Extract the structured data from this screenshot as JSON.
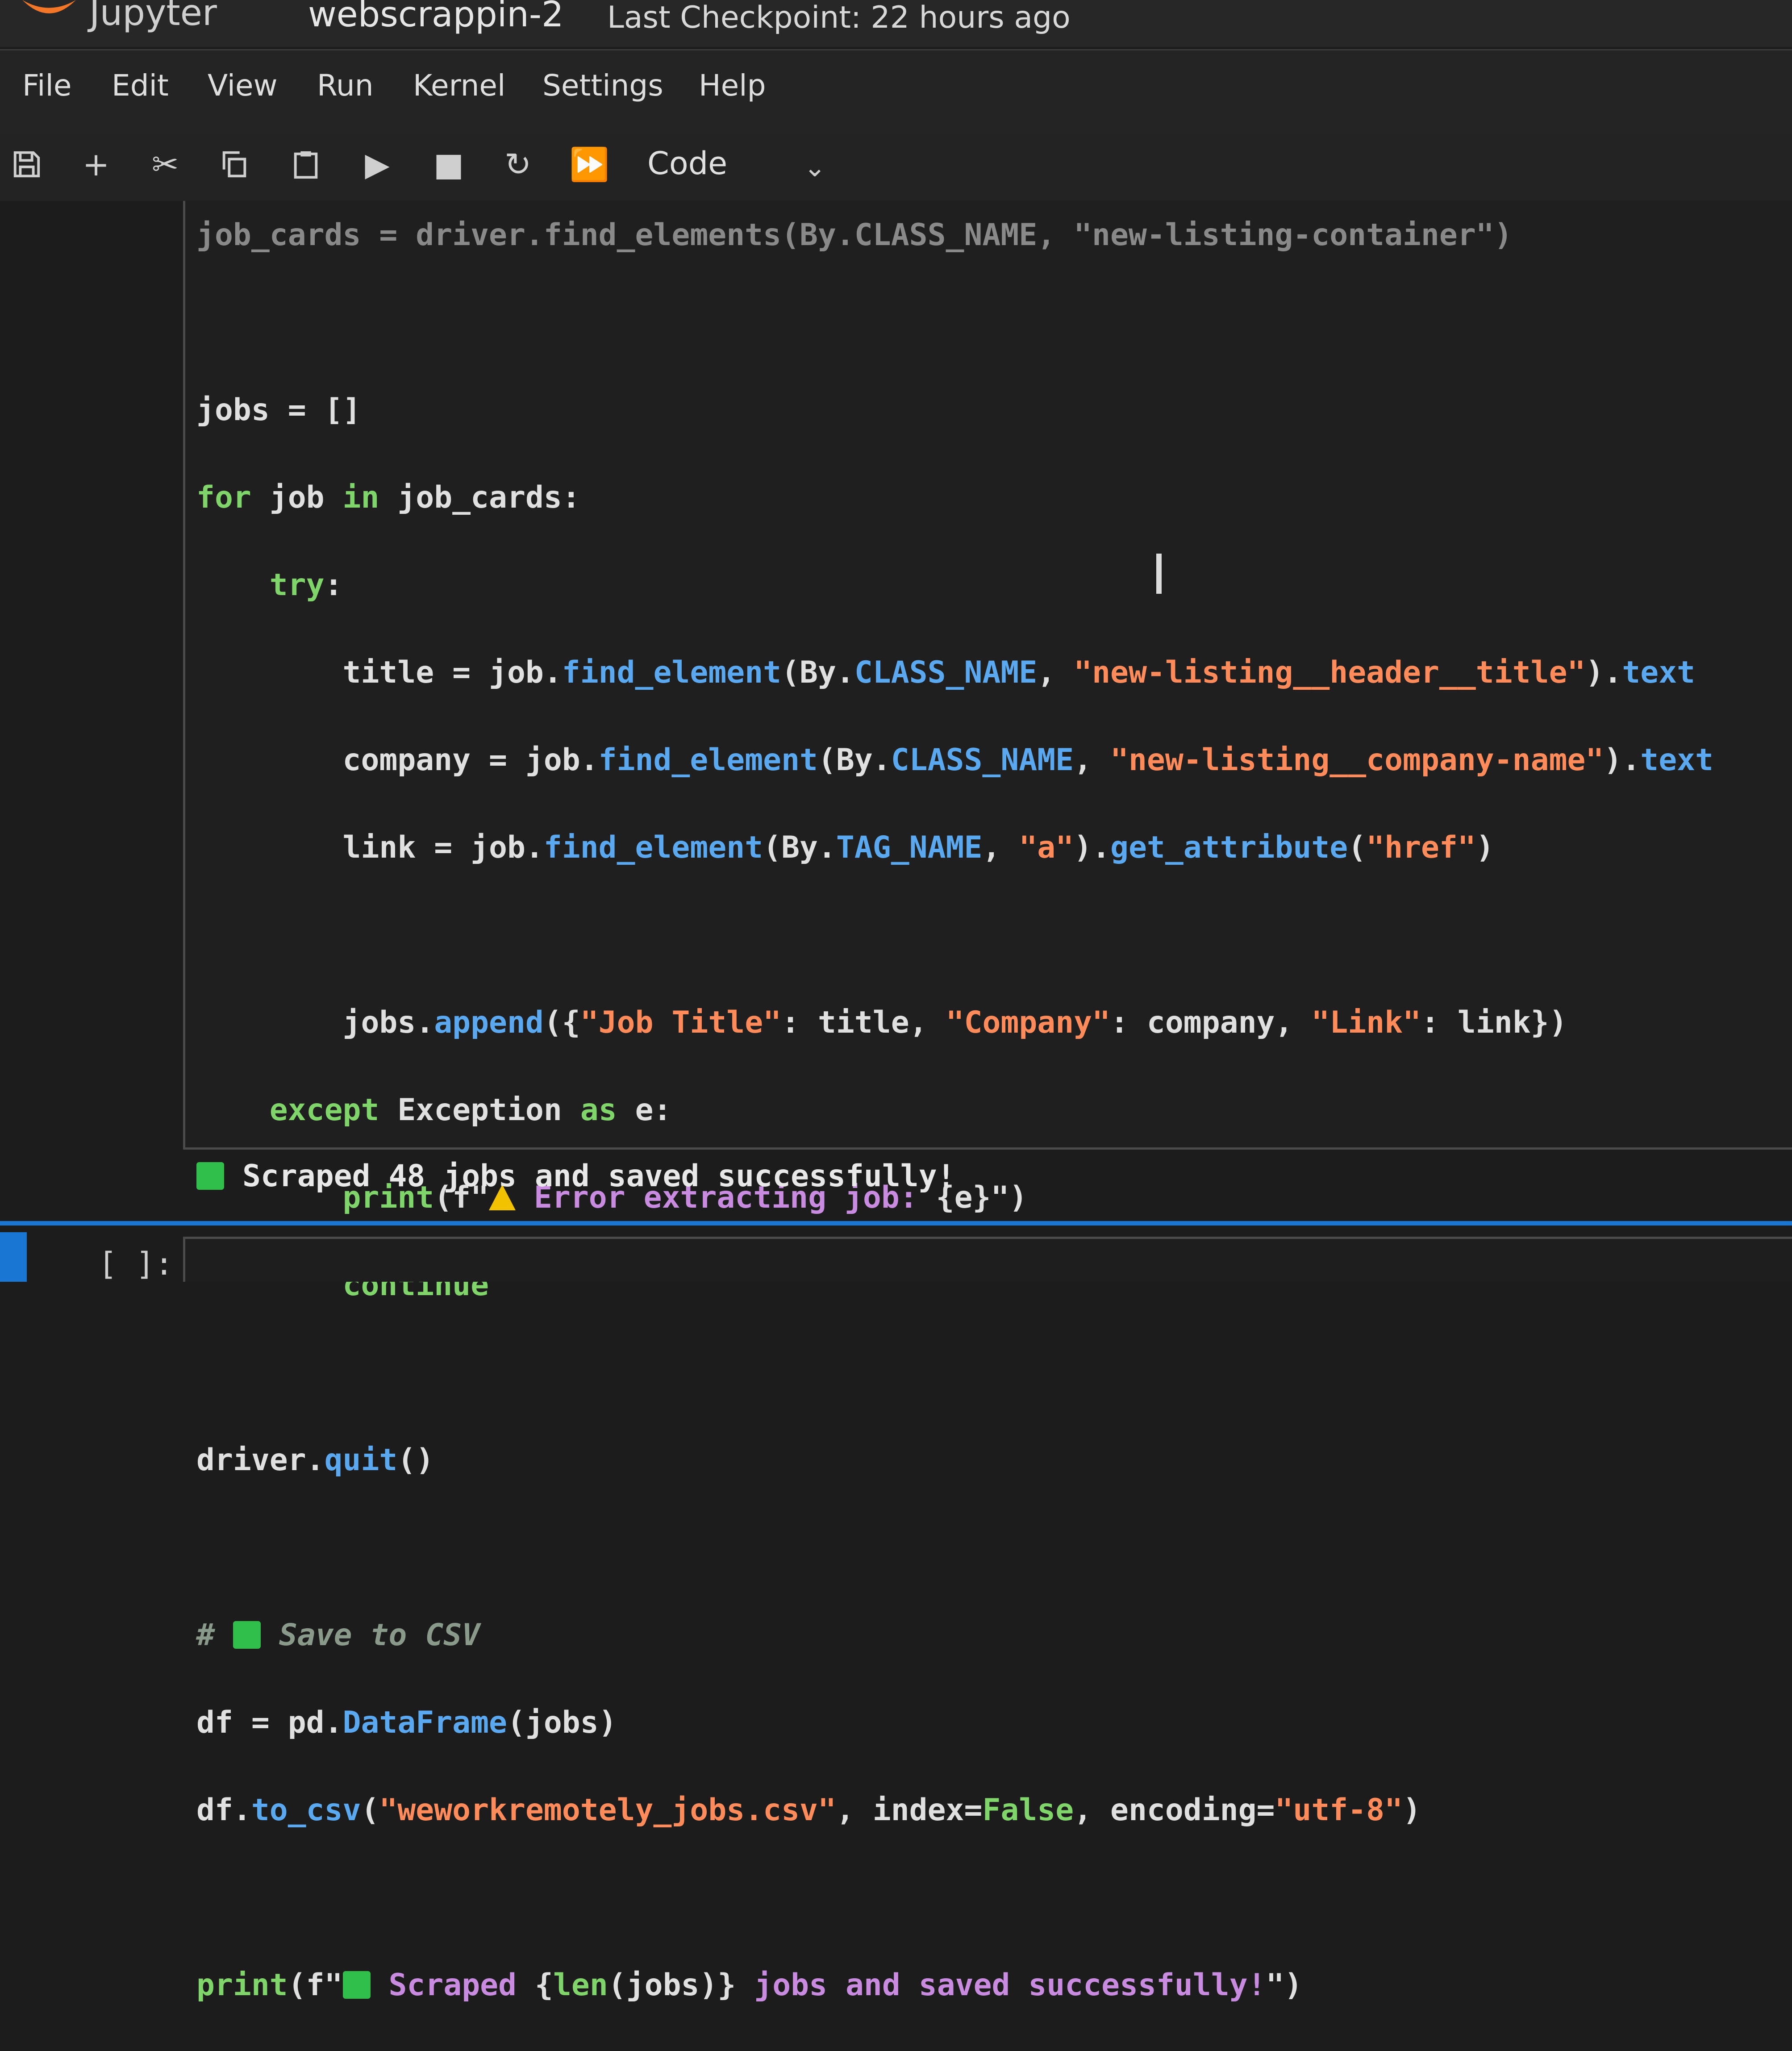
{
  "header": {
    "brand": "Jupyter",
    "notebook_name": "webscrappin-2",
    "checkpoint": "Last Checkpoint: 22 hours ago"
  },
  "menu": [
    "File",
    "Edit",
    "View",
    "Run",
    "Kernel",
    "Settings",
    "Help"
  ],
  "toolbar": {
    "icons": [
      "save-icon",
      "add-icon",
      "cut-icon",
      "copy-icon",
      "paste-icon",
      "run-icon",
      "stop-icon",
      "restart-icon",
      "fast-forward-icon"
    ],
    "cell_type": "Code"
  },
  "code": {
    "l0": "job_cards = driver.find_elements(By.CLASS_NAME, \"new-listing-container\")",
    "l2_a": "jobs",
    "l2_b": " = []",
    "l3_a": "for",
    "l3_b": " job ",
    "l3_c": "in",
    "l3_d": " job_cards:",
    "l4_a": "    ",
    "l4_b": "try",
    "l5_a": "        title = job.",
    "l5_b": "find_element",
    "l5_c": "(By.",
    "l5_d": "CLASS_NAME",
    "l5_e": ", ",
    "l5_f": "\"new-listing__header__title\"",
    "l5_g": ").",
    "l5_h": "text",
    "l6_a": "        company = job.",
    "l6_b": "find_element",
    "l6_c": "(By.",
    "l6_d": "CLASS_NAME",
    "l6_e": ", ",
    "l6_f": "\"new-listing__company-name\"",
    "l6_g": ").",
    "l6_h": "text",
    "l7_a": "        link = job.",
    "l7_b": "find_element",
    "l7_c": "(By.",
    "l7_d": "TAG_NAME",
    "l7_e": ", ",
    "l7_f": "\"a\"",
    "l7_g": ").",
    "l7_h": "get_attribute",
    "l7_i": "(",
    "l7_j": "\"href\"",
    "l7_k": ")",
    "l9_a": "        jobs.",
    "l9_b": "append",
    "l9_c": "({",
    "l9_d": "\"Job Title\"",
    "l9_e": ": title, ",
    "l9_f": "\"Company\"",
    "l9_g": ": company, ",
    "l9_h": "\"Link\"",
    "l9_i": ": link})",
    "l10_a": "    ",
    "l10_b": "except",
    "l10_c": " Exception ",
    "l10_d": "as",
    "l10_e": " e:",
    "l11_a": "        ",
    "l11_b": "print",
    "l11_c": "(f\"",
    "l11_d": " Error extracting job: ",
    "l11_e": "{e}",
    "l11_f": "\")",
    "l12_a": "        ",
    "l12_b": "continue",
    "l14_a": "driver.",
    "l14_b": "quit",
    "l14_c": "()",
    "l16_a": "# ",
    "l16_b": " Save to CSV",
    "l17_a": "df = pd.",
    "l17_b": "DataFrame",
    "l17_c": "(jobs)",
    "l18_a": "df.",
    "l18_b": "to_csv",
    "l18_c": "(",
    "l18_d": "\"weworkremotely_jobs.csv\"",
    "l18_e": ", index=",
    "l18_f": "False",
    "l18_g": ", encoding=",
    "l18_h": "\"utf-8\"",
    "l18_i": ")",
    "l20_a": "print",
    "l20_b": "(f\"",
    "l20_c": " Scraped ",
    "l20_d": "{",
    "l20_e": "len",
    "l20_f": "(jobs)}",
    "l20_g": " jobs and saved successfully!",
    "l20_h": "\")"
  },
  "output": {
    "text": " Scraped 48 jobs and saved successfully!"
  },
  "new_cell": {
    "prompt": "[ ]:"
  },
  "colors": {
    "keyword": "#7fd46a",
    "function": "#5aa9f0",
    "string": "#ff8a5a",
    "fstring": "#c98be0",
    "accent": "#1976d2",
    "check": "#2fbf4a"
  }
}
